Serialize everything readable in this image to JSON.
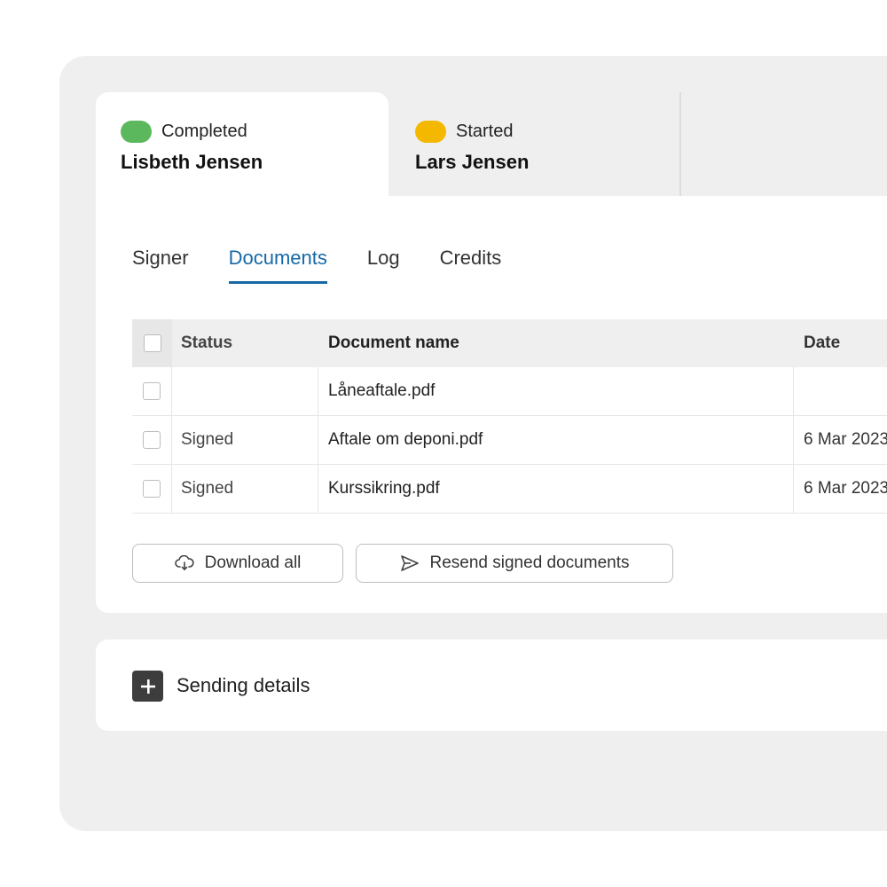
{
  "signers": [
    {
      "status": "Completed",
      "status_color": "#5cb85c",
      "name": "Lisbeth Jensen",
      "active": true
    },
    {
      "status": "Started",
      "status_color": "#f5b800",
      "name": "Lars Jensen",
      "active": false
    }
  ],
  "subtabs": [
    {
      "label": "Signer"
    },
    {
      "label": "Documents"
    },
    {
      "label": "Log"
    },
    {
      "label": "Credits"
    }
  ],
  "active_subtab": "Documents",
  "table": {
    "headers": {
      "status": "Status",
      "name": "Document name",
      "date": "Date"
    },
    "rows": [
      {
        "status": "",
        "name": "Låneaftale.pdf",
        "date": ""
      },
      {
        "status": "Signed",
        "name": "Aftale om deponi.pdf",
        "date": "6 Mar 2023"
      },
      {
        "status": "Signed",
        "name": "Kurssikring.pdf",
        "date": "6 Mar 2023"
      }
    ]
  },
  "actions": {
    "download_all": "Download all",
    "download_icon": "cloud-download-icon",
    "resend": "Resend signed documents",
    "resend_icon": "send-icon"
  },
  "details": {
    "label": "Sending details",
    "icon": "plus-icon"
  },
  "colors": {
    "accent": "#1669a6",
    "completed": "#5cb85c",
    "started": "#f5b800"
  }
}
